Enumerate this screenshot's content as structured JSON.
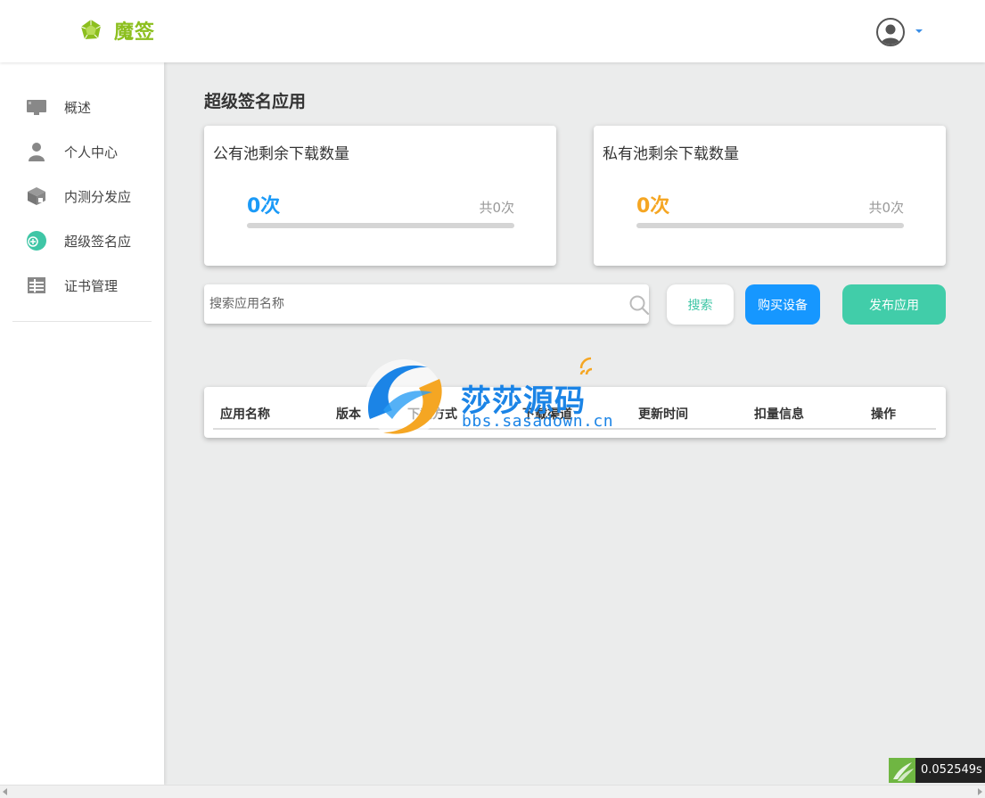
{
  "header": {
    "logo_text": "魔签",
    "logo_icon": "polygon-logo-icon",
    "avatar_icon": "user-avatar-icon",
    "accent_color": "#8cbf1e"
  },
  "sidebar": {
    "items": [
      {
        "label": "概述",
        "icon": "monitor-icon"
      },
      {
        "label": "个人中心",
        "icon": "user-icon"
      },
      {
        "label": "内测分发应",
        "icon": "package-icon"
      },
      {
        "label": "超级签名应",
        "icon": "super-sign-icon"
      },
      {
        "label": "证书管理",
        "icon": "certificate-icon"
      }
    ]
  },
  "main": {
    "title": "超级签名应用",
    "public_pool": {
      "title": "公有池剩余下载数量",
      "remaining": "0次",
      "total": "共0次",
      "used_fraction": 0,
      "color": "#1b9af7"
    },
    "private_pool": {
      "title": "私有池剩余下载数量",
      "remaining": "0次",
      "total": "共0次",
      "used_fraction": 0,
      "color": "#f5a623"
    },
    "search": {
      "placeholder": "搜索应用名称",
      "value": ""
    },
    "buttons": {
      "search": "搜索",
      "buy_device": "购买设备",
      "publish": "发布应用"
    },
    "table": {
      "columns": [
        "应用名称",
        "版本",
        "下载方式",
        "下载渠道",
        "更新时间",
        "扣量信息",
        "操作"
      ],
      "rows": []
    }
  },
  "watermark": {
    "title": "莎莎源码",
    "url": "bbs.sasadown.cn"
  },
  "timer": {
    "value": "0.052549s"
  }
}
